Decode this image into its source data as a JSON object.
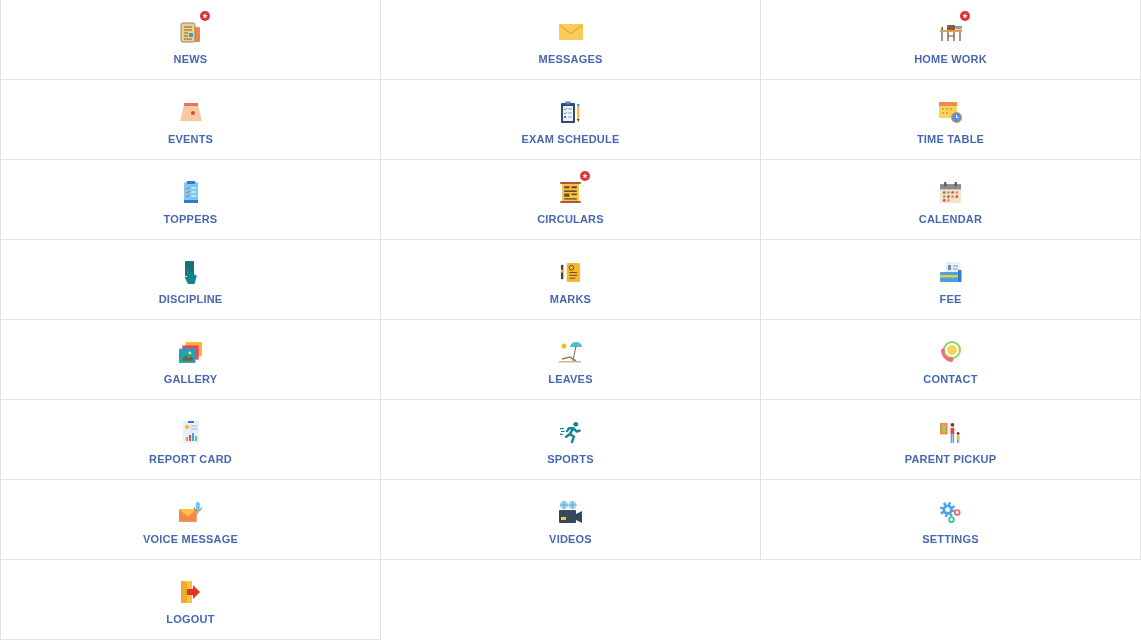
{
  "menu": {
    "items": [
      {
        "label": "NEWS",
        "new": true
      },
      {
        "label": "MESSAGES",
        "new": false
      },
      {
        "label": "HOME WORK",
        "new": true
      },
      {
        "label": "EVENTS",
        "new": false
      },
      {
        "label": "EXAM SCHEDULE",
        "new": false
      },
      {
        "label": "TIME TABLE",
        "new": false
      },
      {
        "label": "TOPPERS",
        "new": false
      },
      {
        "label": "CIRCULARS",
        "new": true
      },
      {
        "label": "CALENDAR",
        "new": false
      },
      {
        "label": "DISCIPLINE",
        "new": false
      },
      {
        "label": "MARKS",
        "new": false
      },
      {
        "label": "FEE",
        "new": false
      },
      {
        "label": "GALLERY",
        "new": false
      },
      {
        "label": "LEAVES",
        "new": false
      },
      {
        "label": "CONTACT",
        "new": false
      },
      {
        "label": "REPORT CARD",
        "new": false
      },
      {
        "label": "SPORTS",
        "new": false
      },
      {
        "label": "PARENT PICKUP",
        "new": false
      },
      {
        "label": "VOICE MESSAGE",
        "new": false
      },
      {
        "label": "VIDEOS",
        "new": false
      },
      {
        "label": "SETTINGS",
        "new": false
      },
      {
        "label": "LOGOUT",
        "new": false
      }
    ]
  }
}
